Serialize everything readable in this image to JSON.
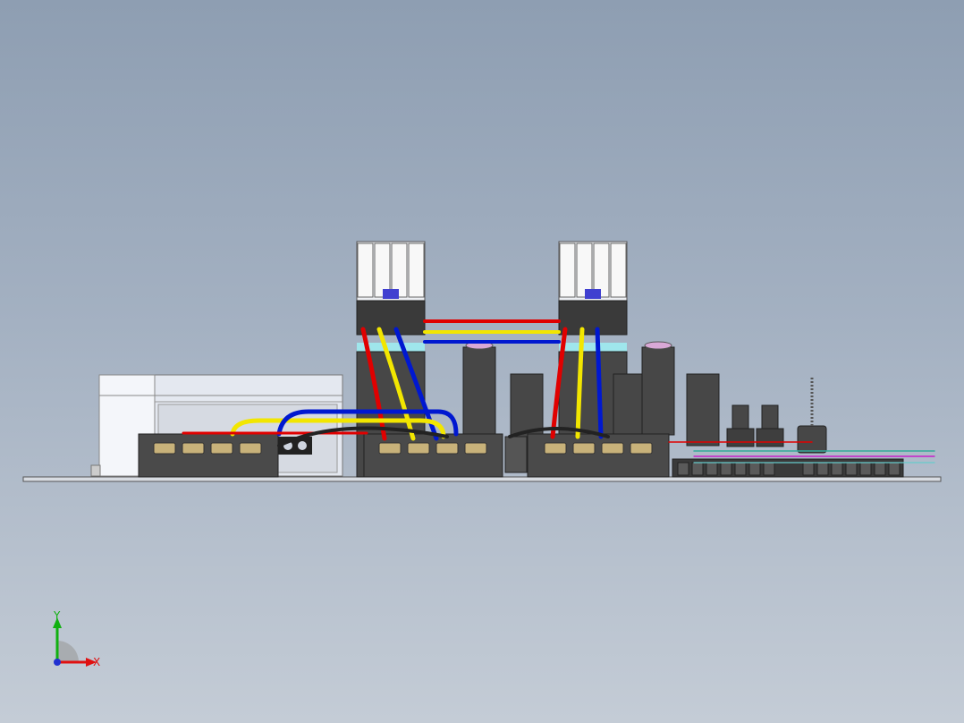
{
  "viewport": {
    "background_top": "#8e9eb2",
    "background_bottom": "#c4ccd6"
  },
  "colors": {
    "housing": "#4a4a4a",
    "housing_dark": "#353535",
    "terminal_screw": "#c8b27a",
    "wire_red": "#e00000",
    "wire_yellow": "#f2e600",
    "wire_blue": "#0018d0",
    "wire_black": "#222222",
    "cyan_band": "#9fe6ec",
    "cap_pink": "#d9a8d6",
    "enclosure": "#e4e8f0",
    "base_plate": "#d8dce2"
  },
  "triad": {
    "x_label": "X",
    "y_label": "Y",
    "x_color": "#e01010",
    "y_color": "#10b010",
    "z_color": "#2030d0"
  },
  "icons": {
    "triad": "coordinate-triad-icon"
  }
}
